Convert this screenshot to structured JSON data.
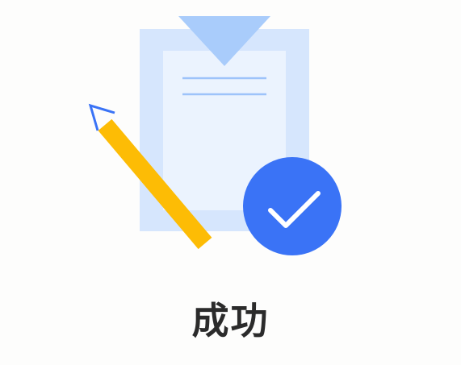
{
  "result": {
    "status": "success",
    "title": "成功"
  },
  "illustration": {
    "icons": [
      "clipboard-icon",
      "pencil-icon",
      "checkmark-badge-icon"
    ]
  },
  "colors": {
    "background": "#FDFDFC",
    "clipboard_outer": "#D6E6FD",
    "clipboard_paper": "#EBF3FE",
    "clipboard_clip": "#A9CCFB",
    "paper_lines": "#9DC3FA",
    "pencil_body": "#FDBC05",
    "pencil_tip": "#3A73F6",
    "badge": "#3A73F6",
    "checkmark": "#FFFFFF",
    "title_text": "#2B2B2B"
  }
}
